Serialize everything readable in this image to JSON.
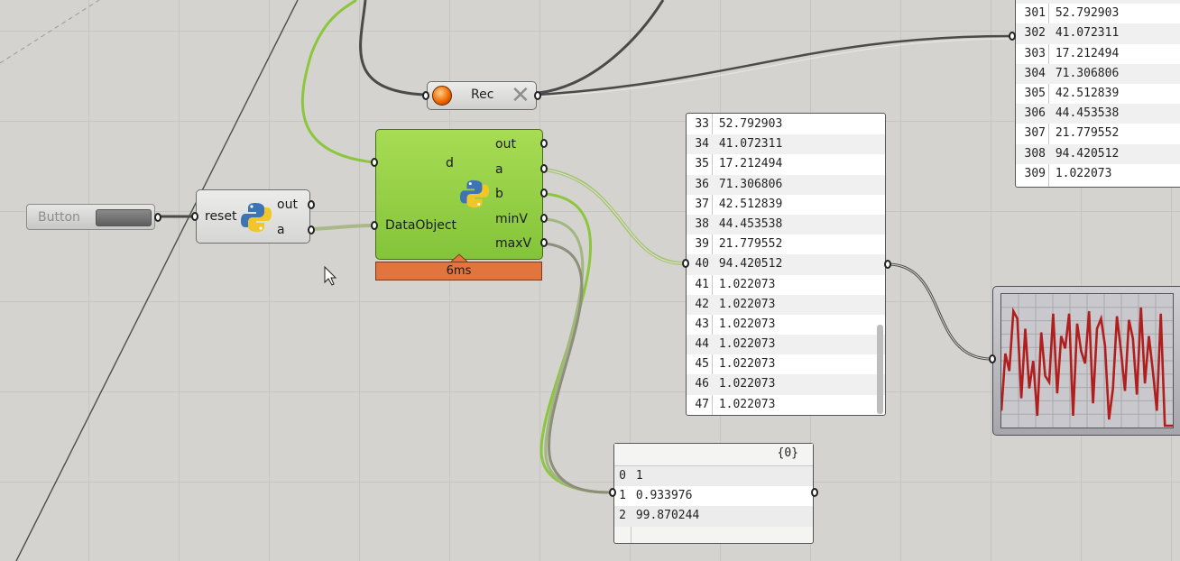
{
  "button": {
    "label": "Button"
  },
  "reset_node": {
    "input": "reset",
    "outputs": [
      "out",
      "a"
    ]
  },
  "rec_node": {
    "label": "Rec"
  },
  "main_node": {
    "inputs": [
      "d",
      "DataObject"
    ],
    "outputs": [
      "out",
      "a",
      "b",
      "minV",
      "maxV"
    ],
    "timer": "6ms"
  },
  "panel_list": {
    "rows": [
      {
        "i": "33",
        "v": "52.792903"
      },
      {
        "i": "34",
        "v": "41.072311"
      },
      {
        "i": "35",
        "v": "17.212494"
      },
      {
        "i": "36",
        "v": "71.306806"
      },
      {
        "i": "37",
        "v": "42.512839"
      },
      {
        "i": "38",
        "v": "44.453538"
      },
      {
        "i": "39",
        "v": "21.779552"
      },
      {
        "i": "40",
        "v": "94.420512"
      },
      {
        "i": "41",
        "v": "1.022073"
      },
      {
        "i": "42",
        "v": "1.022073"
      },
      {
        "i": "43",
        "v": "1.022073"
      },
      {
        "i": "44",
        "v": "1.022073"
      },
      {
        "i": "45",
        "v": "1.022073"
      },
      {
        "i": "46",
        "v": "1.022073"
      },
      {
        "i": "47",
        "v": "1.022073"
      }
    ]
  },
  "panel_top": {
    "rows": [
      {
        "i": "301",
        "v": "52.792903"
      },
      {
        "i": "302",
        "v": "41.072311"
      },
      {
        "i": "303",
        "v": "17.212494"
      },
      {
        "i": "304",
        "v": "71.306806"
      },
      {
        "i": "305",
        "v": "42.512839"
      },
      {
        "i": "306",
        "v": "44.453538"
      },
      {
        "i": "307",
        "v": "21.779552"
      },
      {
        "i": "308",
        "v": "94.420512"
      },
      {
        "i": "309",
        "v": "1.022073"
      }
    ]
  },
  "panel_small": {
    "header": "{0}",
    "rows": [
      {
        "i": "0",
        "v": "1"
      },
      {
        "i": "1",
        "v": "0.933976"
      },
      {
        "i": "2",
        "v": "99.870244"
      }
    ]
  },
  "graph": {
    "values": [
      12,
      58,
      44,
      92,
      86,
      22,
      78,
      30,
      52,
      8,
      75,
      40,
      35,
      90,
      26,
      72,
      62,
      90,
      8,
      82,
      60,
      50,
      92,
      18,
      78,
      86,
      64,
      5,
      30,
      88,
      60,
      28,
      85,
      70,
      25,
      95,
      34,
      72,
      44,
      12,
      90,
      0,
      0,
      0
    ]
  },
  "colors": {
    "accent_green": "#8cc63f",
    "timer_orange": "#e2743e",
    "wire_dark": "#4a4a48",
    "graph_line": "#b01e1e"
  }
}
